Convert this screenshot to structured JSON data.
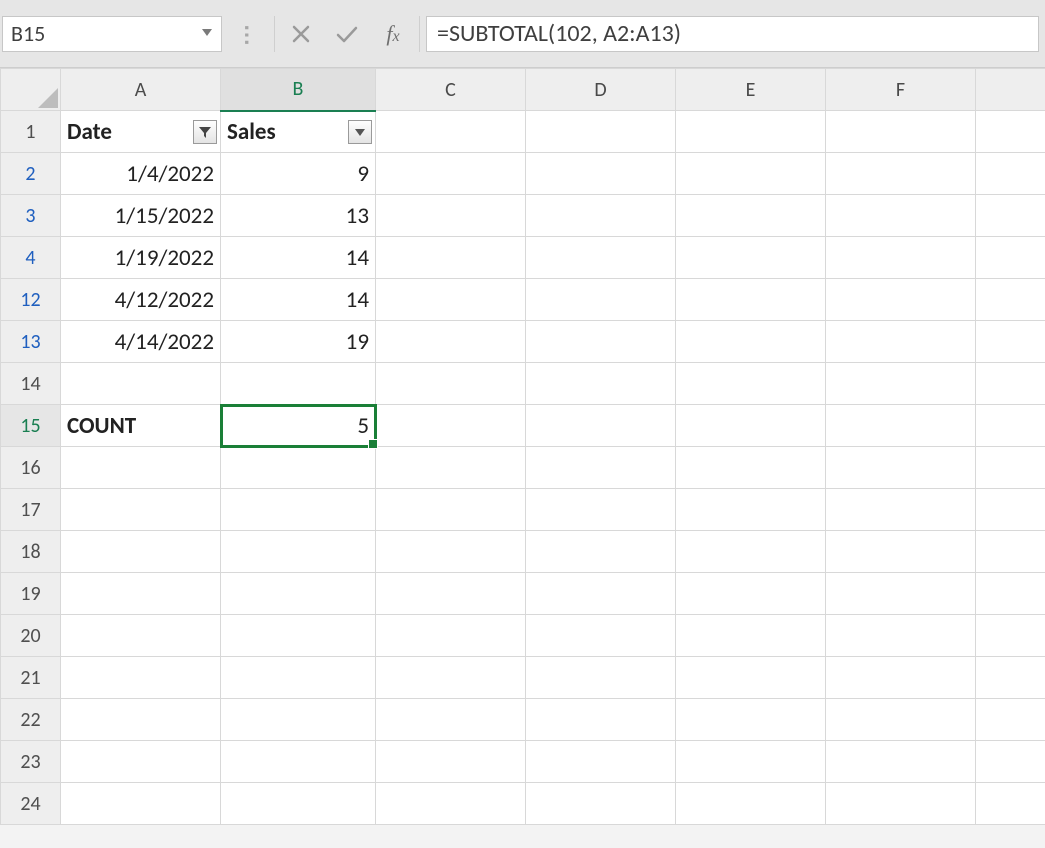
{
  "name_box": "B15",
  "formula": "=SUBTOTAL(102, A2:A13)",
  "columns": [
    "A",
    "B",
    "C",
    "D",
    "E",
    "F"
  ],
  "headers": {
    "A": {
      "label": "Date",
      "filter": "active"
    },
    "B": {
      "label": "Sales",
      "filter": "dropdown"
    }
  },
  "rows": [
    {
      "num": "1",
      "type": "header"
    },
    {
      "num": "2",
      "filtered": true,
      "A": "1/4/2022",
      "B": "9"
    },
    {
      "num": "3",
      "filtered": true,
      "A": "1/15/2022",
      "B": "13"
    },
    {
      "num": "4",
      "filtered": true,
      "A": "1/19/2022",
      "B": "14"
    },
    {
      "num": "12",
      "filtered": true,
      "A": "4/12/2022",
      "B": "14"
    },
    {
      "num": "13",
      "filtered": true,
      "A": "4/14/2022",
      "B": "19"
    },
    {
      "num": "14"
    },
    {
      "num": "15",
      "A": "COUNT",
      "A_bold": true,
      "B": "5",
      "selected": "B"
    },
    {
      "num": "16"
    },
    {
      "num": "17"
    },
    {
      "num": "18"
    },
    {
      "num": "19"
    },
    {
      "num": "20"
    },
    {
      "num": "21"
    },
    {
      "num": "22"
    },
    {
      "num": "23"
    },
    {
      "num": "24"
    }
  ],
  "active_column": "B",
  "active_row": "15"
}
